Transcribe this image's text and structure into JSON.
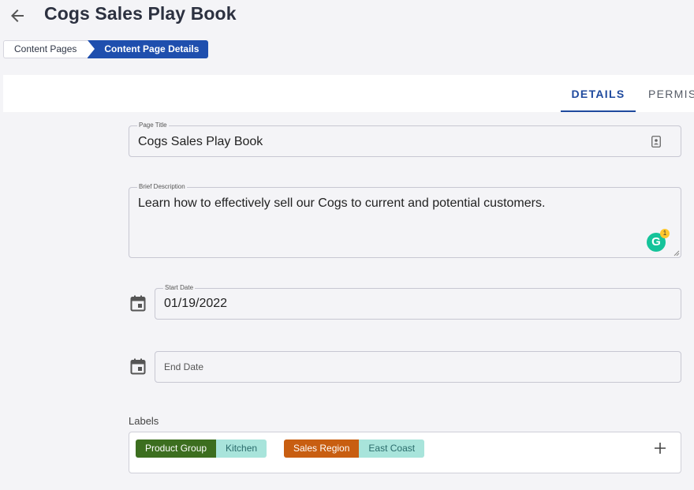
{
  "header": {
    "title": "Cogs Sales Play Book",
    "back_icon": "arrow-left-icon"
  },
  "breadcrumb": {
    "items": [
      {
        "label": "Content Pages",
        "active": false
      },
      {
        "label": "Content Page Details",
        "active": true
      }
    ],
    "active_color": "#1f4fae"
  },
  "tabs": [
    {
      "label": "DETAILS",
      "active": true
    },
    {
      "label": "PERMIS",
      "active": false
    }
  ],
  "form": {
    "page_title": {
      "label": "Page Title",
      "value": "Cogs Sales Play Book",
      "icon": "contact-card-icon"
    },
    "brief_description": {
      "label": "Brief Description",
      "value": "Learn how to effectively sell our Cogs to current and potential customers.",
      "grammarly_letter": "G",
      "grammarly_count": "1"
    },
    "start_date": {
      "label": "Start Date",
      "value": "01/19/2022",
      "icon": "calendar-icon"
    },
    "end_date": {
      "placeholder": "End Date",
      "value": "",
      "icon": "calendar-icon"
    }
  },
  "labels": {
    "title": "Labels",
    "chips": [
      {
        "key": "Product Group",
        "value": "Kitchen",
        "key_color": "#3c6e1f",
        "value_color": "#a8e4db"
      },
      {
        "key": "Sales Region",
        "value": "East Coast",
        "key_color": "#c85e11",
        "value_color": "#a8e4db"
      }
    ],
    "add_icon": "plus-icon"
  }
}
